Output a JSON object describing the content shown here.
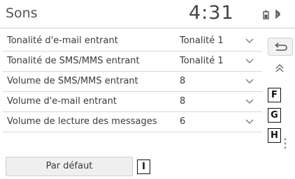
{
  "header": {
    "title": "Sons",
    "clock": "4:31",
    "status_icons": [
      "battery-icon",
      "bluetooth-icon"
    ]
  },
  "rows": [
    {
      "label": "Tonalité d'e-mail entrant",
      "value": "Tonalité 1"
    },
    {
      "label": "Tonalité de SMS/MMS entrant",
      "value": "Tonalité 1"
    },
    {
      "label": "Volume de SMS/MMS entrant",
      "value": "8",
      "callout": "F"
    },
    {
      "label": "Volume d'e-mail entrant",
      "value": "8",
      "callout": "G"
    },
    {
      "label": "Volume de lecture des messages",
      "value": "6",
      "callout": "H"
    }
  ],
  "side_controls": [
    "back-icon",
    "page-up-icon"
  ],
  "default_button": {
    "label": "Par défaut",
    "callout": "I"
  }
}
